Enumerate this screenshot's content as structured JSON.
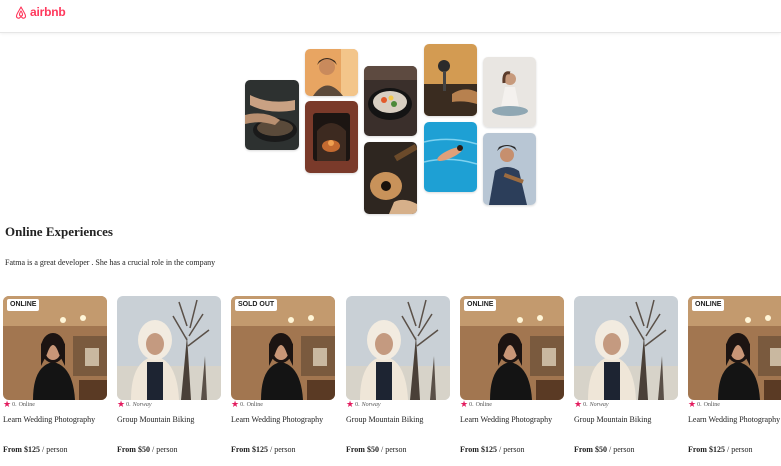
{
  "header": {
    "logo_text": "airbnb",
    "brand_color": "#ff385c"
  },
  "section": {
    "title": "Online Experiences",
    "description": "Fatma is a great developer . She has a crucial role in the company"
  },
  "cards": [
    {
      "badge": "ONLINE",
      "rating": "0.",
      "location": "Online",
      "title": "Learn Wedding Photography",
      "price": "From $125",
      "unit": "/ person",
      "image": "woman-portrait"
    },
    {
      "badge": "",
      "rating": "0.",
      "location": "Norway",
      "title": "Group Mountain Biking",
      "price": "From $50",
      "unit": "/ person",
      "image": "snow-portrait"
    },
    {
      "badge": "SOLD OUT",
      "rating": "0.",
      "location": "Online",
      "title": "Learn Wedding Photography",
      "price": "From $125",
      "unit": "/ person",
      "image": "woman-portrait"
    },
    {
      "badge": "",
      "rating": "0.",
      "location": "Norway",
      "title": "Group Mountain Biking",
      "price": "From $50",
      "unit": "/ person",
      "image": "snow-portrait"
    },
    {
      "badge": "ONLINE",
      "rating": "0.",
      "location": "Online",
      "title": "Learn Wedding Photography",
      "price": "From $125",
      "unit": "/ person",
      "image": "woman-portrait"
    },
    {
      "badge": "",
      "rating": "0.",
      "location": "Norway",
      "title": "Group Mountain Biking",
      "price": "From $50",
      "unit": "/ person",
      "image": "snow-portrait"
    },
    {
      "badge": "ONLINE",
      "rating": "0.",
      "location": "Online",
      "title": "Learn Wedding Photography",
      "price": "From $125",
      "unit": "/ person",
      "image": "woman-portrait"
    }
  ],
  "star_color": "#e31c5f"
}
